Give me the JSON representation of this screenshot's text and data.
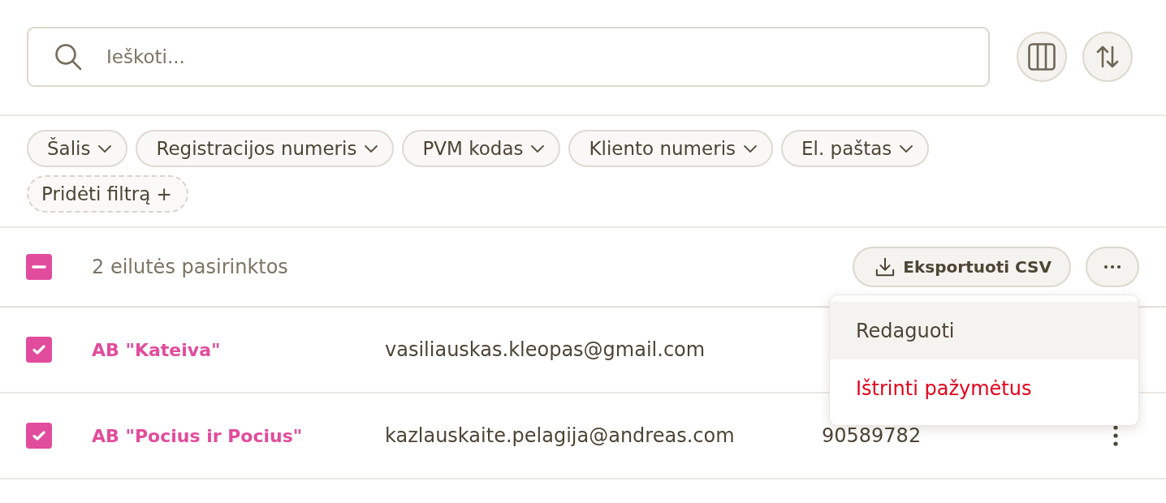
{
  "search": {
    "placeholder": "Ieškoti..."
  },
  "filters": [
    {
      "label": "Šalis",
      "kind": "dropdown"
    },
    {
      "label": "Registracijos numeris",
      "kind": "dropdown"
    },
    {
      "label": "PVM kodas",
      "kind": "dropdown"
    },
    {
      "label": "Kliento numeris",
      "kind": "dropdown"
    },
    {
      "label": "El. paštas",
      "kind": "dropdown"
    },
    {
      "label": "Pridėti filtrą +",
      "kind": "add"
    }
  ],
  "selection_bar": {
    "select_all": {
      "indeterminate": true
    },
    "text": "2 eilutės pasirinktos",
    "export_button": "Eksportuoti CSV"
  },
  "menu": {
    "open": true,
    "items": [
      {
        "label": "Redaguoti",
        "kind": "normal",
        "highlighted": true
      },
      {
        "label": "Ištrinti pažymėtus",
        "kind": "danger",
        "highlighted": false
      }
    ]
  },
  "rows": [
    {
      "selected": true,
      "name": "AB \"Kateiva\"",
      "email": "vasiliauskas.kleopas@gmail.com",
      "more_icon": false
    },
    {
      "selected": true,
      "name": "AB \"Pocius ir Pocius\"",
      "email": "kazlauskaite.pelagija@andreas.com",
      "column_3": "90589782",
      "more_icon": true
    }
  ]
}
